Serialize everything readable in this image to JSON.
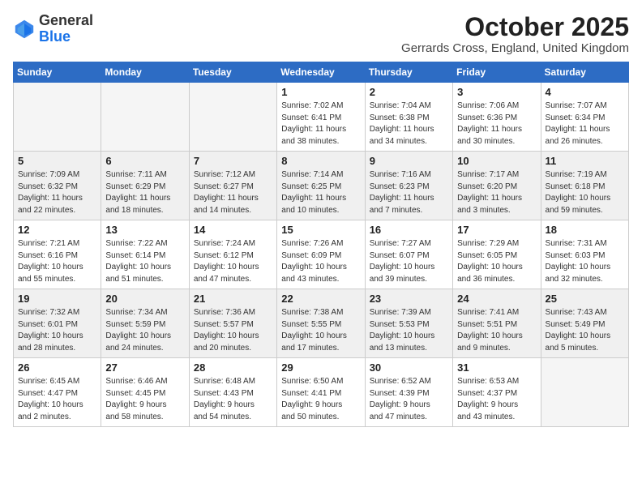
{
  "logo": {
    "general": "General",
    "blue": "Blue"
  },
  "header": {
    "month": "October 2025",
    "location": "Gerrards Cross, England, United Kingdom"
  },
  "weekdays": [
    "Sunday",
    "Monday",
    "Tuesday",
    "Wednesday",
    "Thursday",
    "Friday",
    "Saturday"
  ],
  "weeks": [
    [
      {
        "day": "",
        "info": ""
      },
      {
        "day": "",
        "info": ""
      },
      {
        "day": "",
        "info": ""
      },
      {
        "day": "1",
        "info": "Sunrise: 7:02 AM\nSunset: 6:41 PM\nDaylight: 11 hours\nand 38 minutes."
      },
      {
        "day": "2",
        "info": "Sunrise: 7:04 AM\nSunset: 6:38 PM\nDaylight: 11 hours\nand 34 minutes."
      },
      {
        "day": "3",
        "info": "Sunrise: 7:06 AM\nSunset: 6:36 PM\nDaylight: 11 hours\nand 30 minutes."
      },
      {
        "day": "4",
        "info": "Sunrise: 7:07 AM\nSunset: 6:34 PM\nDaylight: 11 hours\nand 26 minutes."
      }
    ],
    [
      {
        "day": "5",
        "info": "Sunrise: 7:09 AM\nSunset: 6:32 PM\nDaylight: 11 hours\nand 22 minutes."
      },
      {
        "day": "6",
        "info": "Sunrise: 7:11 AM\nSunset: 6:29 PM\nDaylight: 11 hours\nand 18 minutes."
      },
      {
        "day": "7",
        "info": "Sunrise: 7:12 AM\nSunset: 6:27 PM\nDaylight: 11 hours\nand 14 minutes."
      },
      {
        "day": "8",
        "info": "Sunrise: 7:14 AM\nSunset: 6:25 PM\nDaylight: 11 hours\nand 10 minutes."
      },
      {
        "day": "9",
        "info": "Sunrise: 7:16 AM\nSunset: 6:23 PM\nDaylight: 11 hours\nand 7 minutes."
      },
      {
        "day": "10",
        "info": "Sunrise: 7:17 AM\nSunset: 6:20 PM\nDaylight: 11 hours\nand 3 minutes."
      },
      {
        "day": "11",
        "info": "Sunrise: 7:19 AM\nSunset: 6:18 PM\nDaylight: 10 hours\nand 59 minutes."
      }
    ],
    [
      {
        "day": "12",
        "info": "Sunrise: 7:21 AM\nSunset: 6:16 PM\nDaylight: 10 hours\nand 55 minutes."
      },
      {
        "day": "13",
        "info": "Sunrise: 7:22 AM\nSunset: 6:14 PM\nDaylight: 10 hours\nand 51 minutes."
      },
      {
        "day": "14",
        "info": "Sunrise: 7:24 AM\nSunset: 6:12 PM\nDaylight: 10 hours\nand 47 minutes."
      },
      {
        "day": "15",
        "info": "Sunrise: 7:26 AM\nSunset: 6:09 PM\nDaylight: 10 hours\nand 43 minutes."
      },
      {
        "day": "16",
        "info": "Sunrise: 7:27 AM\nSunset: 6:07 PM\nDaylight: 10 hours\nand 39 minutes."
      },
      {
        "day": "17",
        "info": "Sunrise: 7:29 AM\nSunset: 6:05 PM\nDaylight: 10 hours\nand 36 minutes."
      },
      {
        "day": "18",
        "info": "Sunrise: 7:31 AM\nSunset: 6:03 PM\nDaylight: 10 hours\nand 32 minutes."
      }
    ],
    [
      {
        "day": "19",
        "info": "Sunrise: 7:32 AM\nSunset: 6:01 PM\nDaylight: 10 hours\nand 28 minutes."
      },
      {
        "day": "20",
        "info": "Sunrise: 7:34 AM\nSunset: 5:59 PM\nDaylight: 10 hours\nand 24 minutes."
      },
      {
        "day": "21",
        "info": "Sunrise: 7:36 AM\nSunset: 5:57 PM\nDaylight: 10 hours\nand 20 minutes."
      },
      {
        "day": "22",
        "info": "Sunrise: 7:38 AM\nSunset: 5:55 PM\nDaylight: 10 hours\nand 17 minutes."
      },
      {
        "day": "23",
        "info": "Sunrise: 7:39 AM\nSunset: 5:53 PM\nDaylight: 10 hours\nand 13 minutes."
      },
      {
        "day": "24",
        "info": "Sunrise: 7:41 AM\nSunset: 5:51 PM\nDaylight: 10 hours\nand 9 minutes."
      },
      {
        "day": "25",
        "info": "Sunrise: 7:43 AM\nSunset: 5:49 PM\nDaylight: 10 hours\nand 5 minutes."
      }
    ],
    [
      {
        "day": "26",
        "info": "Sunrise: 6:45 AM\nSunset: 4:47 PM\nDaylight: 10 hours\nand 2 minutes."
      },
      {
        "day": "27",
        "info": "Sunrise: 6:46 AM\nSunset: 4:45 PM\nDaylight: 9 hours\nand 58 minutes."
      },
      {
        "day": "28",
        "info": "Sunrise: 6:48 AM\nSunset: 4:43 PM\nDaylight: 9 hours\nand 54 minutes."
      },
      {
        "day": "29",
        "info": "Sunrise: 6:50 AM\nSunset: 4:41 PM\nDaylight: 9 hours\nand 50 minutes."
      },
      {
        "day": "30",
        "info": "Sunrise: 6:52 AM\nSunset: 4:39 PM\nDaylight: 9 hours\nand 47 minutes."
      },
      {
        "day": "31",
        "info": "Sunrise: 6:53 AM\nSunset: 4:37 PM\nDaylight: 9 hours\nand 43 minutes."
      },
      {
        "day": "",
        "info": ""
      }
    ]
  ]
}
